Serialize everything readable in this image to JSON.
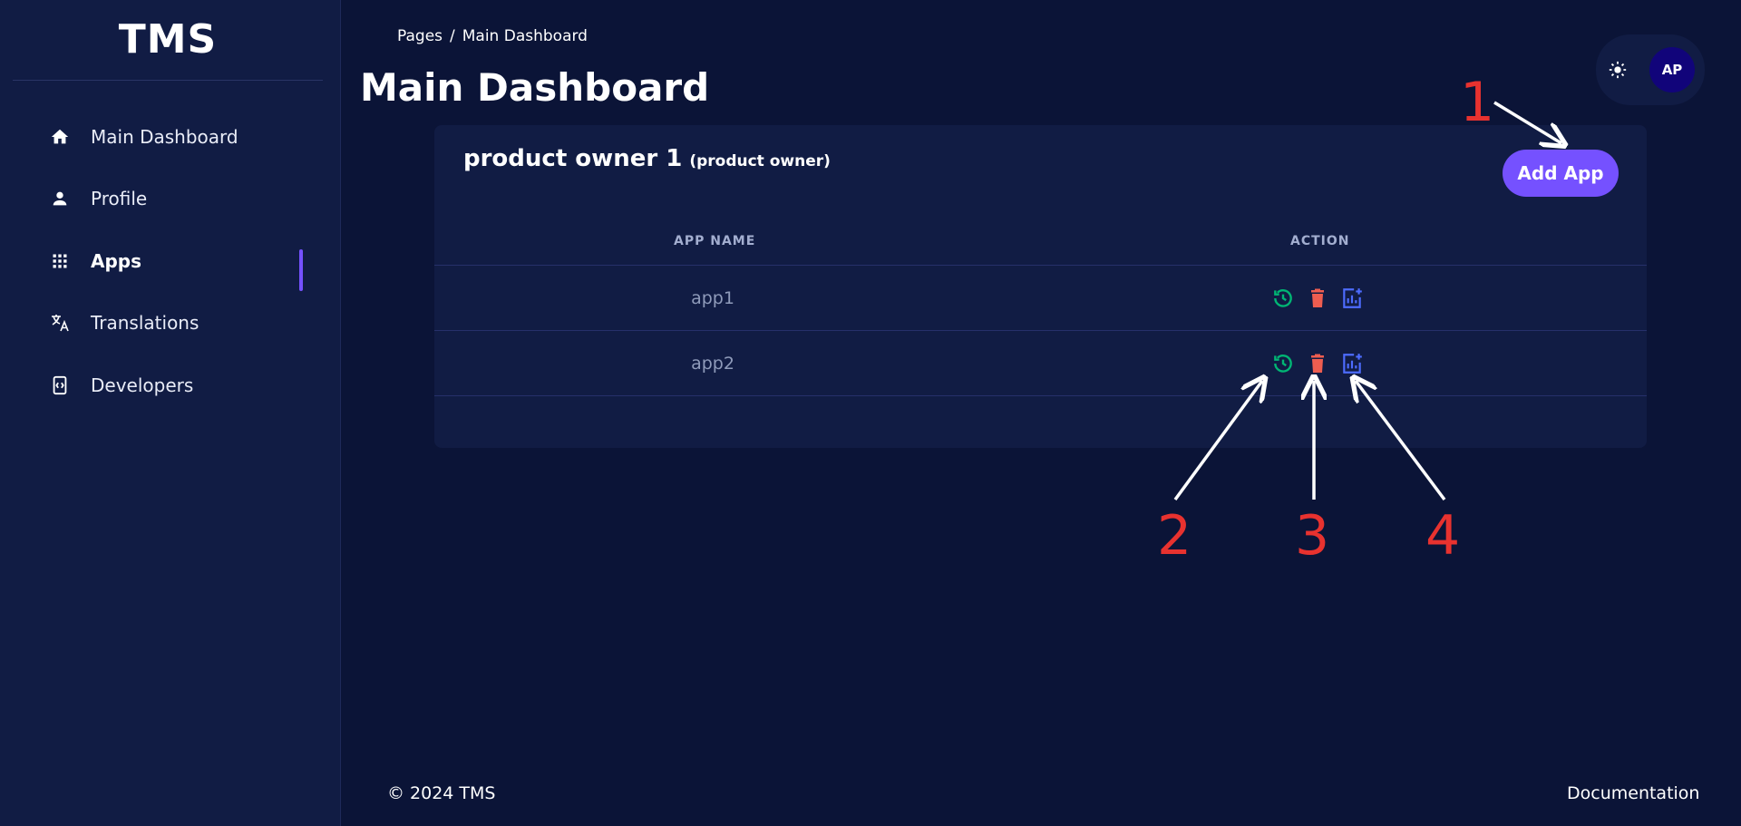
{
  "sidebar": {
    "brand": "TMS",
    "items": [
      {
        "label": "Main Dashboard",
        "icon": "home-icon"
      },
      {
        "label": "Profile",
        "icon": "person-icon"
      },
      {
        "label": "Apps",
        "icon": "grid-icon",
        "active": true
      },
      {
        "label": "Translations",
        "icon": "translate-icon"
      },
      {
        "label": "Developers",
        "icon": "code-phone-icon"
      }
    ]
  },
  "header": {
    "breadcrumb": [
      "Pages",
      "/",
      "Main Dashboard"
    ],
    "title": "Main Dashboard",
    "avatar_initials": "AP",
    "theme_icon": "sun-icon"
  },
  "card": {
    "owner_name": "product owner 1",
    "owner_role": "(product owner)",
    "add_button": "Add App",
    "columns": [
      "APP NAME",
      "ACTION"
    ],
    "rows": [
      {
        "name": "app1",
        "actions": [
          "history-icon",
          "trash-icon",
          "chart-add-icon"
        ]
      },
      {
        "name": "app2",
        "actions": [
          "history-icon",
          "trash-icon",
          "chart-add-icon"
        ]
      }
    ]
  },
  "annotations": [
    "1",
    "2",
    "3",
    "4"
  ],
  "footer": {
    "copyright": "© 2024 TMS",
    "documentation": "Documentation"
  },
  "colors": {
    "background": "#0b1437",
    "panel": "#111c44",
    "accent": "#7551ff",
    "history": "#01b574",
    "delete": "#ee5d50",
    "chart": "#4d6cff",
    "annotation": "#e8322f"
  }
}
